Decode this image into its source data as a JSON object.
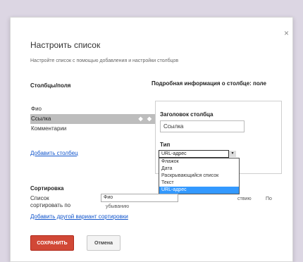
{
  "dialog": {
    "title": "Настроить список",
    "subtitle": "Настройте список с помощью добавления и настройки столбцов",
    "close_glyph": "×"
  },
  "columns": {
    "header": "Столбцы/поля",
    "items": [
      {
        "label": "Фио"
      },
      {
        "label": "Ссылка",
        "handle": "◆ ◆"
      },
      {
        "label": "Комментарии"
      }
    ],
    "add_link": "Добавить столбец"
  },
  "details": {
    "header": "Подробная информация о столбце: поле",
    "colname_label": "Заголовок столбца",
    "colname_value": "Ссылка",
    "type_label": "Тип",
    "type_selected": "URL-адрес",
    "type_arrow": "▾",
    "type_options": [
      "Флажок",
      "Дата",
      "Раскрывающийся список",
      "Текст",
      "URL-адрес"
    ]
  },
  "sorting": {
    "header": "Сортировка",
    "label": "Список сортировать по",
    "field_value": "Фио",
    "order_text": "убыванию",
    "tail_text": "ствию",
    "tail_text2": "По",
    "add_link": "Добавить другой вариант сортировки"
  },
  "buttons": {
    "save_label": "СОХРАНИТЬ",
    "cancel_label": "Отмена"
  }
}
